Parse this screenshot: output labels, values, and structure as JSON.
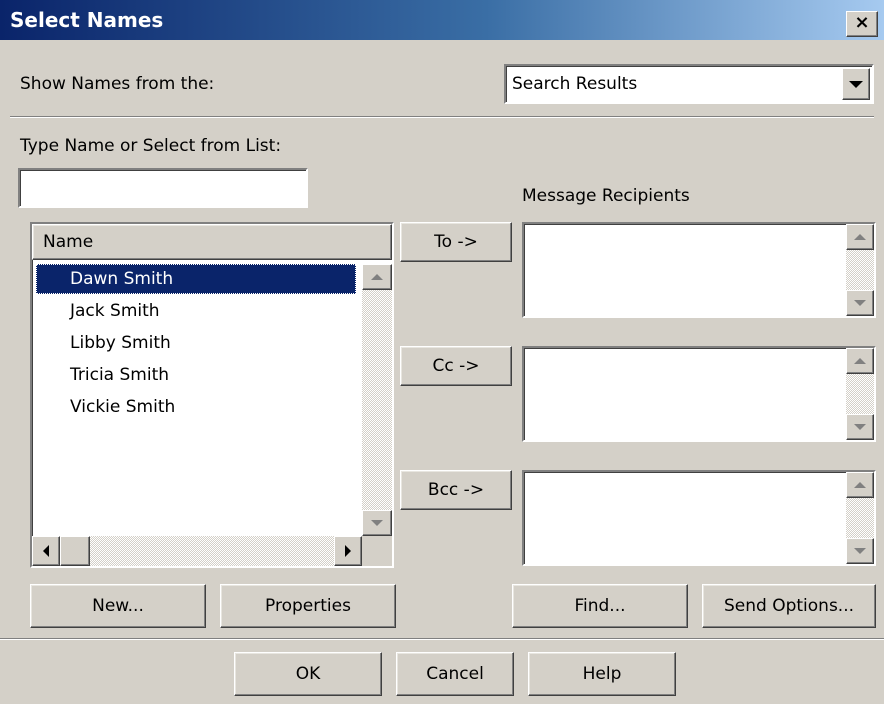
{
  "window": {
    "title": "Select Names",
    "close_glyph": "×"
  },
  "show_from": {
    "label": "Show Names from the:",
    "selected": "Search Results"
  },
  "type_name": {
    "label": "Type Name or Select from List:",
    "value": ""
  },
  "names_list": {
    "header": "Name",
    "items": [
      "Dawn Smith",
      "Jack Smith",
      "Libby Smith",
      "Tricia Smith",
      "Vickie Smith"
    ],
    "selected_index": 0
  },
  "recipients": {
    "label": "Message Recipients",
    "to_label": "To ->",
    "cc_label": "Cc ->",
    "bcc_label": "Bcc ->"
  },
  "actions": {
    "new": "New...",
    "properties": "Properties",
    "find": "Find...",
    "send_options": "Send Options..."
  },
  "footer": {
    "ok": "OK",
    "cancel": "Cancel",
    "help": "Help"
  }
}
